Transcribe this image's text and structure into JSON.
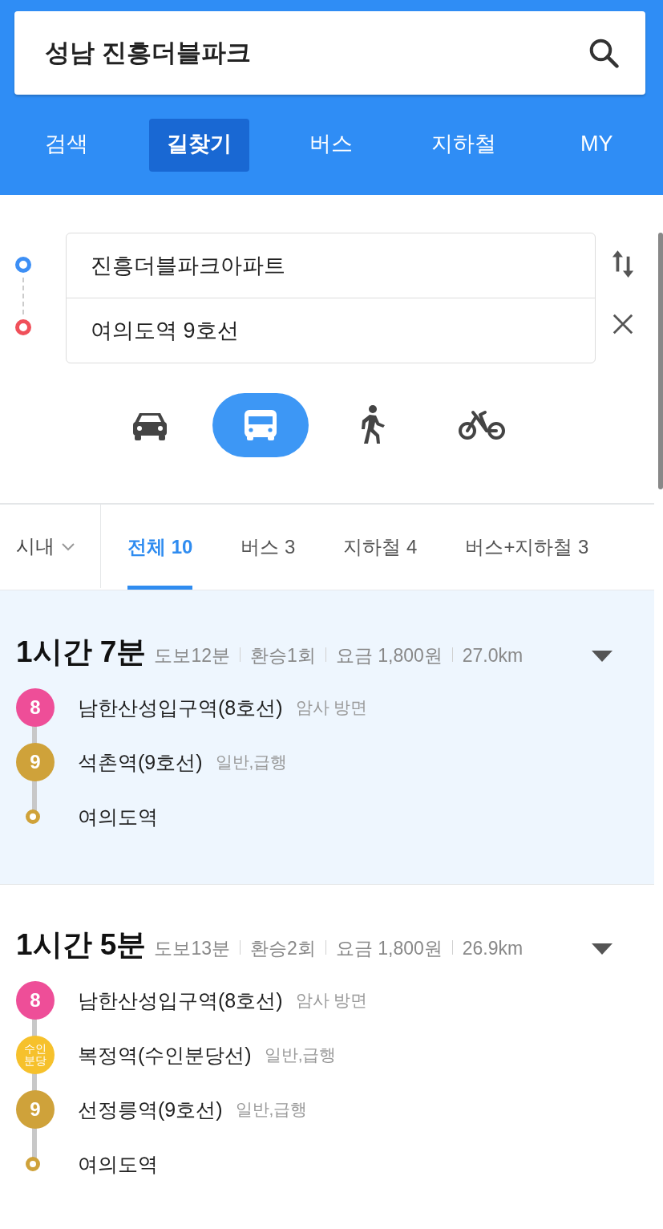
{
  "search": {
    "value": "성남 진흥더블파크"
  },
  "nav_tabs": [
    {
      "label": "검색",
      "selected": false
    },
    {
      "label": "길찾기",
      "selected": true
    },
    {
      "label": "버스",
      "selected": false
    },
    {
      "label": "지하철",
      "selected": false
    },
    {
      "label": "MY",
      "selected": false
    }
  ],
  "route_inputs": [
    {
      "kind": "origin",
      "value": "진흥더블파크아파트"
    },
    {
      "kind": "destination",
      "value": "여의도역 9호선"
    }
  ],
  "modes": [
    {
      "kind": "car",
      "selected": false
    },
    {
      "kind": "bus",
      "selected": true
    },
    {
      "kind": "walk",
      "selected": false
    },
    {
      "kind": "bike",
      "selected": false
    }
  ],
  "region_dropdown": {
    "label": "시내"
  },
  "filter_tabs": [
    {
      "label": "전체 10",
      "selected": true
    },
    {
      "label": "버스 3",
      "selected": false
    },
    {
      "label": "지하철 4",
      "selected": false
    },
    {
      "label": "버스+지하철 3",
      "selected": false
    }
  ],
  "routes": [
    {
      "selected": true,
      "duration": "1시간 7분",
      "meta": [
        "도보12분",
        "환승1회",
        "요금 1,800원",
        "27.0km"
      ],
      "steps": [
        {
          "kind": "line",
          "badge": "8",
          "color": "#ee4e98",
          "station": "남한산성입구역(8호선)",
          "detail": "암사 방면"
        },
        {
          "kind": "line",
          "badge": "9",
          "color": "#cfa23a",
          "station": "석촌역(9호선)",
          "detail": "일반,급행"
        },
        {
          "kind": "end",
          "color": "#cfa23a",
          "station": "여의도역"
        }
      ]
    },
    {
      "selected": false,
      "duration": "1시간 5분",
      "meta": [
        "도보13분",
        "환승2회",
        "요금 1,800원",
        "26.9km"
      ],
      "steps": [
        {
          "kind": "line",
          "badge": "8",
          "color": "#ee4e98",
          "station": "남한산성입구역(8호선)",
          "detail": "암사 방면"
        },
        {
          "kind": "line",
          "badge": "수인분당",
          "color": "#f6c12c",
          "station": "복정역(수인분당선)",
          "detail": "일반,급행"
        },
        {
          "kind": "line",
          "badge": "9",
          "color": "#cfa23a",
          "station": "선정릉역(9호선)",
          "detail": "일반,급행"
        },
        {
          "kind": "end",
          "color": "#cfa23a",
          "station": "여의도역"
        }
      ]
    }
  ]
}
